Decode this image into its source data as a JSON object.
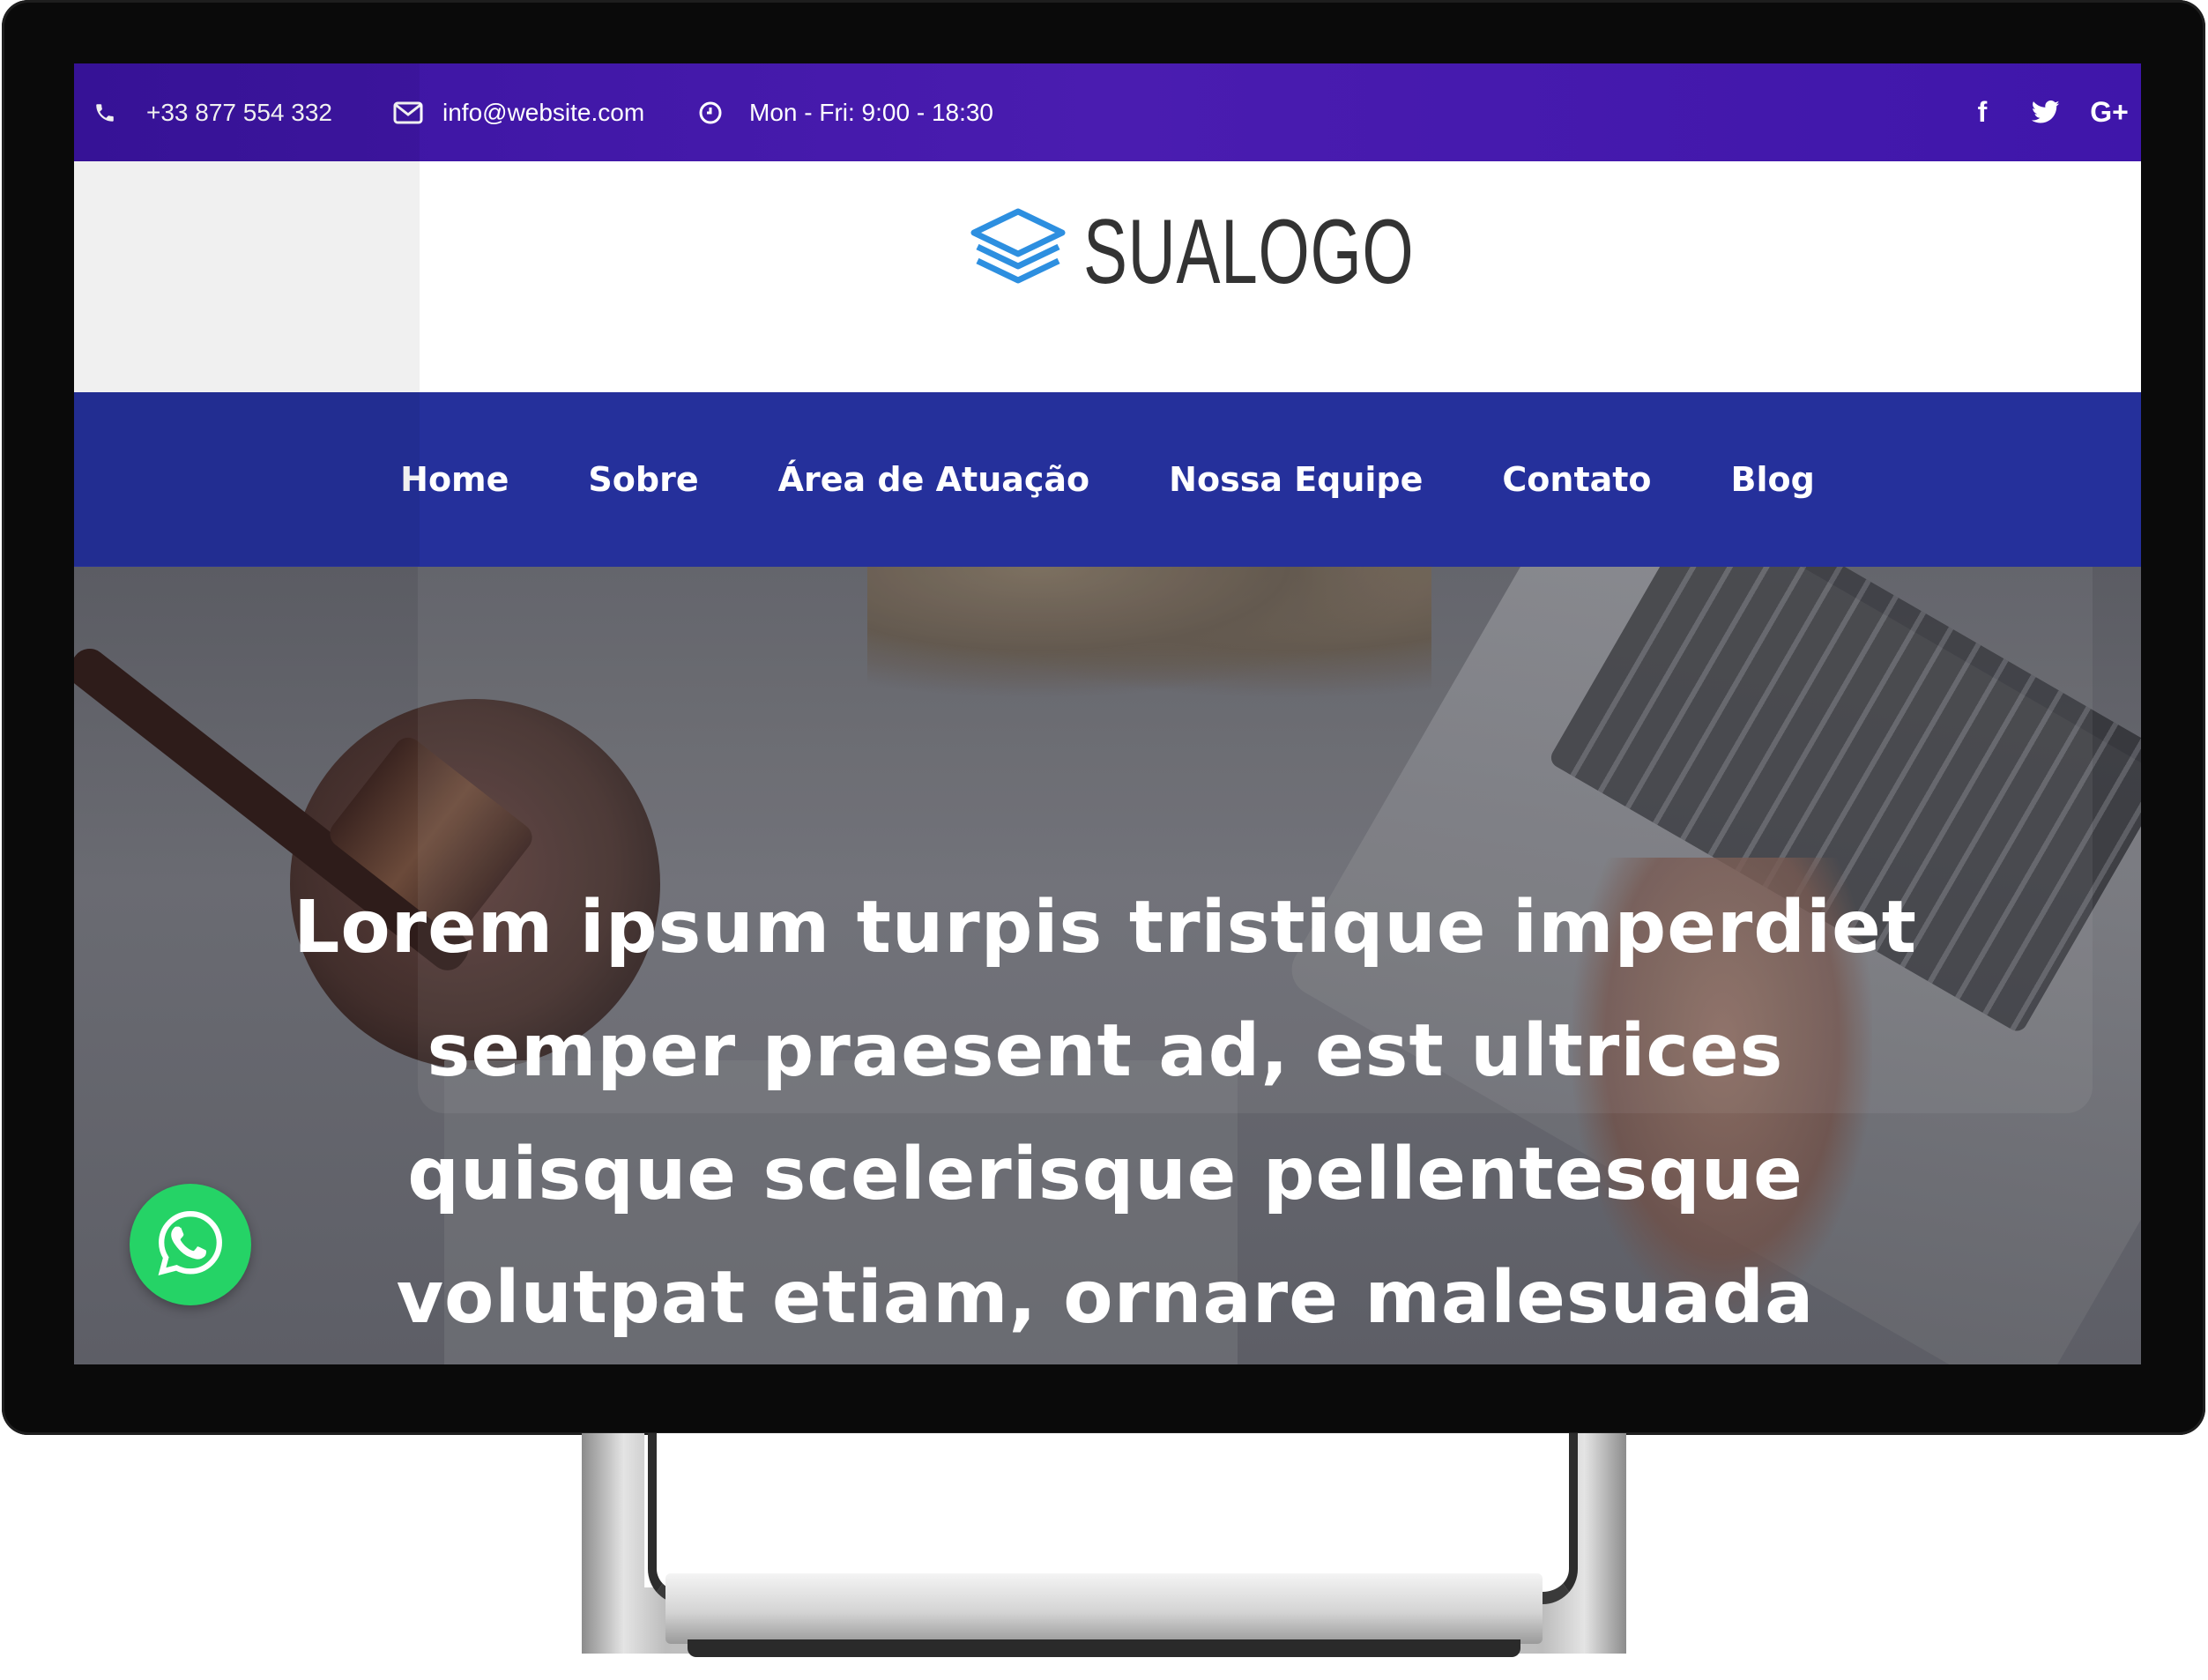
{
  "topbar": {
    "phone": "+33 877 554 332",
    "email": "info@website.com",
    "hours": "Mon - Fri: 9:00 - 18:30",
    "icons": {
      "phone": "phone-icon",
      "email": "envelope-icon",
      "hours": "clock-icon"
    },
    "social": [
      {
        "name": "facebook-icon",
        "glyph": "f"
      },
      {
        "name": "twitter-icon",
        "glyph": "🐦"
      },
      {
        "name": "google-plus-icon",
        "glyph": "G+"
      }
    ]
  },
  "logo": {
    "text": "SUALOGO",
    "icon": "stacked-layers-icon"
  },
  "nav": {
    "items": [
      {
        "label": "Home"
      },
      {
        "label": "Sobre"
      },
      {
        "label": "Área de Atuação"
      },
      {
        "label": "Nossa Equipe"
      },
      {
        "label": "Contato"
      },
      {
        "label": "Blog"
      }
    ]
  },
  "hero": {
    "title_lines": [
      "Lorem ipsum turpis tristique imperdiet",
      "semper praesent ad, est ultrices",
      "quisque scelerisque pellentesque",
      "volutpat etiam, ornare malesuada"
    ]
  },
  "floating": {
    "whatsapp": "whatsapp-icon"
  },
  "colors": {
    "topbar": "#4a1cb0",
    "nav": "#25309b",
    "whatsapp": "#25d366",
    "logo_blue": "#2d8fe0"
  }
}
